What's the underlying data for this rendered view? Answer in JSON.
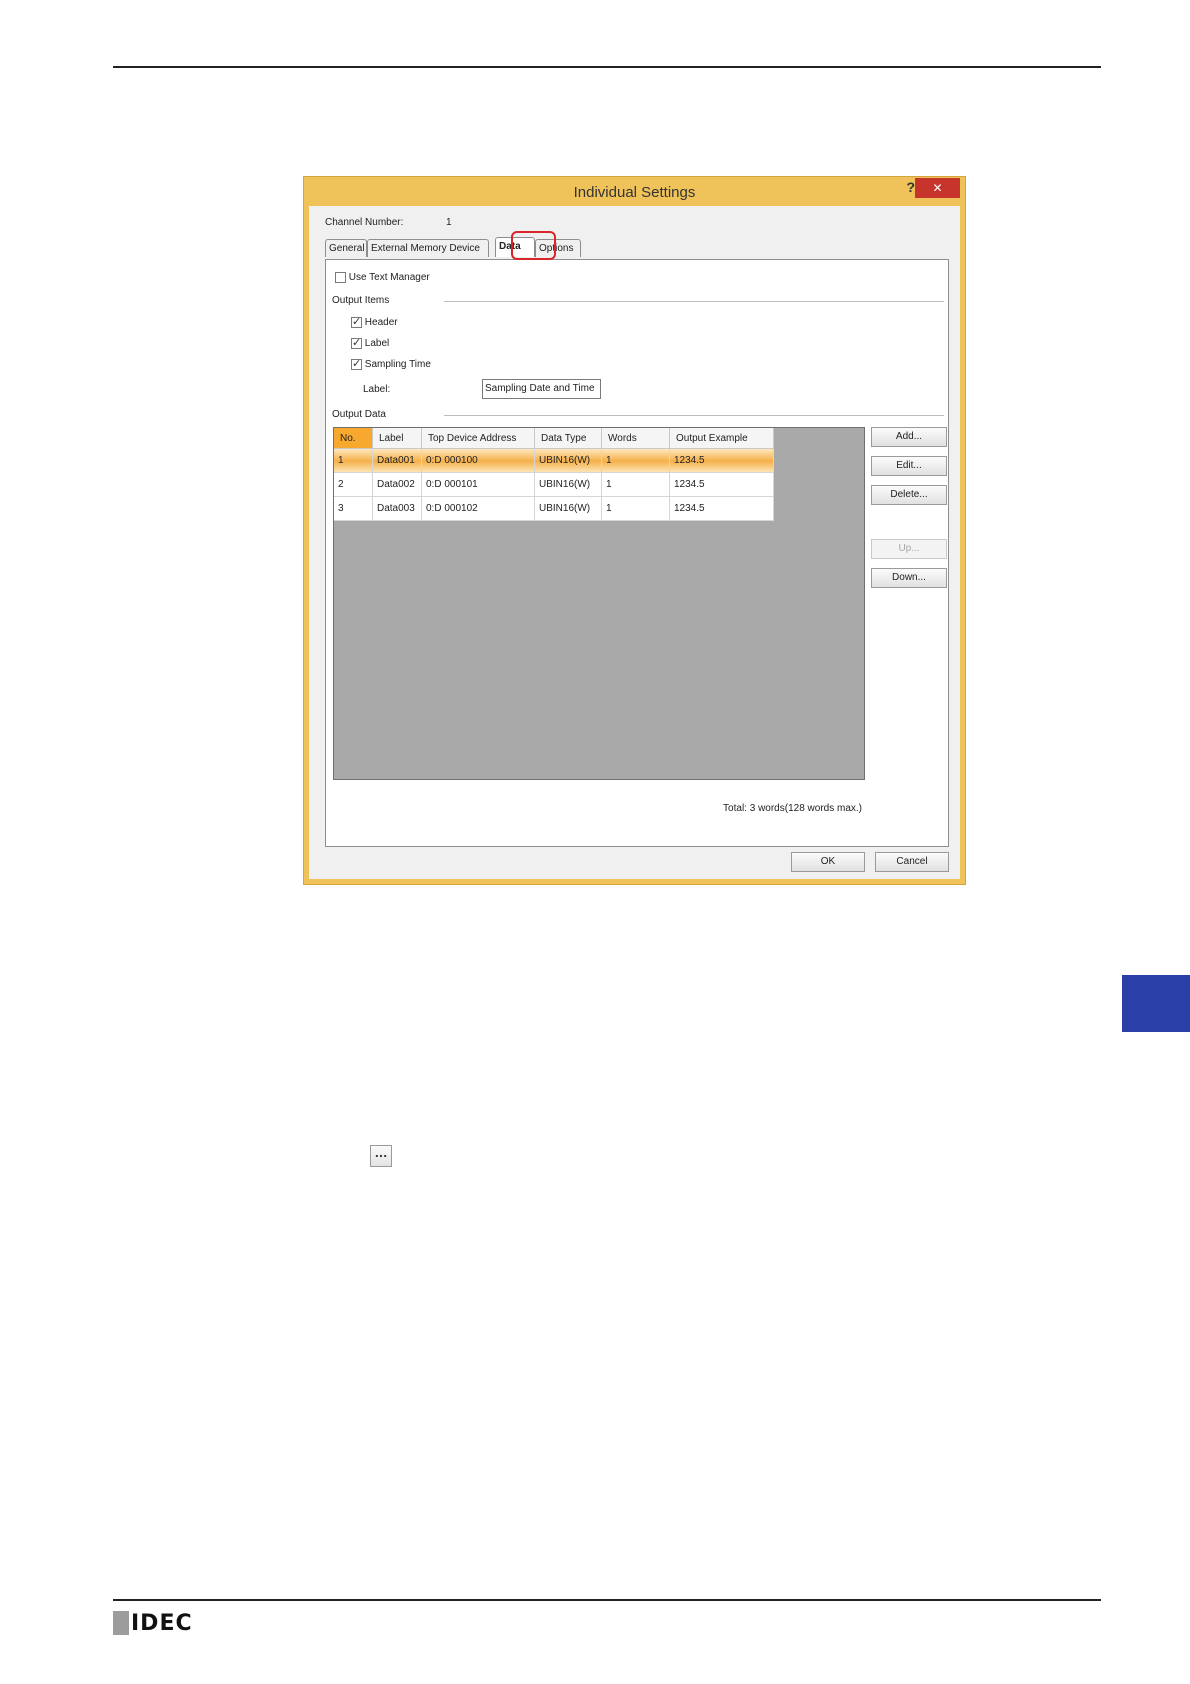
{
  "dialog": {
    "title": "Individual Settings",
    "help_label": "?",
    "close_label": "✕",
    "channel_number_label": "Channel Number:",
    "channel_number_value": "1",
    "tabs": [
      {
        "label": "General"
      },
      {
        "label": "External Memory Device"
      },
      {
        "label": "Data"
      },
      {
        "label": "Options"
      }
    ],
    "active_tab": "Data",
    "use_text_manager": {
      "label": "Use Text Manager",
      "checked": false
    },
    "output_items": {
      "group_label": "Output Items",
      "header": {
        "label": "Header",
        "checked": true
      },
      "label": {
        "label": "Label",
        "checked": true
      },
      "sampling_time": {
        "label": "Sampling Time",
        "checked": true
      },
      "time_label_caption": "Label:",
      "time_label_value": "Sampling Date and Time"
    },
    "output_data": {
      "group_label": "Output Data",
      "columns": [
        "No.",
        "Label",
        "Top Device Address",
        "Data Type",
        "Words",
        "Output Example"
      ],
      "rows": [
        [
          "1",
          "Data001",
          "0:D 000100",
          "UBIN16(W)",
          "1",
          "1234.5"
        ],
        [
          "2",
          "Data002",
          "0:D 000101",
          "UBIN16(W)",
          "1",
          "1234.5"
        ],
        [
          "3",
          "Data003",
          "0:D 000102",
          "UBIN16(W)",
          "1",
          "1234.5"
        ]
      ],
      "selected_row": 1,
      "total": "Total: 3 words(128 words max.)"
    },
    "side_buttons": {
      "add": "Add...",
      "edit": "Edit...",
      "delete": "Delete...",
      "up": "Up...",
      "down": "Down..."
    },
    "ok_label": "OK",
    "cancel_label": "Cancel"
  },
  "page": {
    "ellipsis_button": "...",
    "logo_text": "IDEC",
    "accent_color": "#2b3fa8",
    "dialog_frame_color": "#f0c35a",
    "highlight_color": "#d9262b"
  }
}
